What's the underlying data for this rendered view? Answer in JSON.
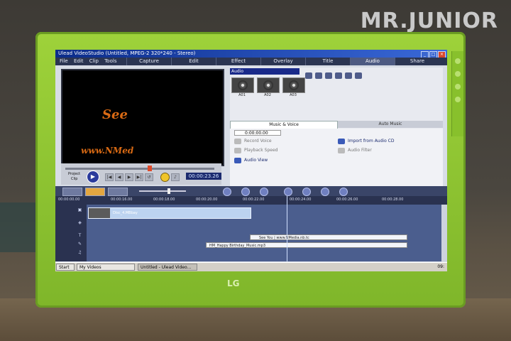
{
  "watermark": "MR.JUNIOR",
  "monitor": {
    "brand": "LG"
  },
  "app": {
    "title": "Ulead VideoStudio (Untitled, MPEG-2 320*240 - Stereo)",
    "menus": [
      "File",
      "Edit",
      "Clip",
      "Tools"
    ],
    "steps": [
      "Capture",
      "Edit",
      "Effect",
      "Overlay",
      "Title",
      "Audio",
      "Share"
    ],
    "active_step": "Audio"
  },
  "preview": {
    "text1": "See",
    "text2": "www.NMed",
    "mode_project": "Project",
    "mode_clip": "Clip",
    "timecode": "00:00:23.26"
  },
  "library": {
    "category": "Audio",
    "thumbs": [
      "A01",
      "A02",
      "A03"
    ]
  },
  "options": {
    "tabs": [
      "Music & Voice",
      "Auto Music"
    ],
    "duration": "0:00:00.00",
    "record_voice": "Record Voice",
    "playback_speed": "Playback Speed",
    "audio_view": "Audio View",
    "import_cd": "Import from Audio CD",
    "audio_filter": "Audio Filter"
  },
  "timeline": {
    "ruler": [
      "00:00:00.00",
      "00:00:16.00",
      "00:00:18.00",
      "00:00:20.00",
      "00:00:22.00",
      "00:00:24.00",
      "00:00:26.00",
      "00:00:28.00"
    ],
    "video_clip": "Disc_4.MBbay",
    "title_clip": "See You | www.NMedia.nb.tc",
    "music_clip": "HM_Happy Birthday_Music.mp3"
  },
  "taskbar": {
    "start": "Start",
    "items": [
      "My Videos",
      "Untitled - Ulead Video..."
    ],
    "clock": "09:"
  }
}
